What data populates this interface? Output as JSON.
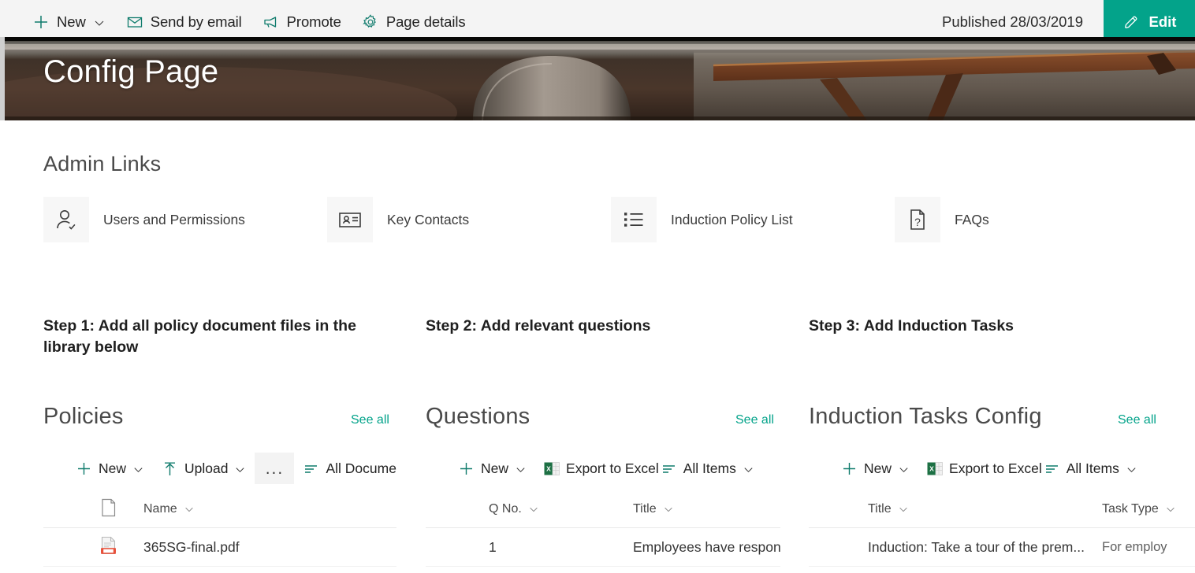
{
  "commandbar": {
    "items": [
      {
        "label": "New",
        "icon": "plus-icon",
        "has_chevron": true
      },
      {
        "label": "Send by email",
        "icon": "mail-icon",
        "has_chevron": false
      },
      {
        "label": "Promote",
        "icon": "megaphone-icon",
        "has_chevron": false
      },
      {
        "label": "Page details",
        "icon": "gear-icon",
        "has_chevron": false
      }
    ],
    "published_status": "Published 28/03/2019",
    "edit_label": "Edit",
    "edit_icon": "pencil-icon",
    "accent_color": "#03a38a"
  },
  "hero": {
    "title": "Config Page"
  },
  "admin_links": {
    "heading": "Admin Links",
    "items": [
      {
        "label": "Users and Permissions",
        "icon": "user-check-icon"
      },
      {
        "label": "Key Contacts",
        "icon": "contact-card-icon"
      },
      {
        "label": "Induction Policy List",
        "icon": "bulleted-list-icon"
      },
      {
        "label": "FAQs",
        "icon": "question-document-icon"
      }
    ]
  },
  "steps": [
    {
      "text": "Step 1: Add all policy document files in the library below"
    },
    {
      "text": "Step 2: Add relevant questions"
    },
    {
      "text": "Step 3: Add Induction Tasks"
    }
  ],
  "webparts": [
    {
      "title": "Policies",
      "see_all": "See all",
      "toolbar": [
        {
          "label": "New",
          "icon": "plus-icon",
          "has_chevron": true
        },
        {
          "label": "Upload",
          "icon": "upload-arrow-icon",
          "has_chevron": true
        },
        {
          "label": "...",
          "icon": "ellipsis-icon",
          "is_ellipsis": true
        },
        {
          "label": "All Documents",
          "icon": "view-list-icon",
          "has_chevron": true
        }
      ],
      "columns": [
        {
          "label": "",
          "icon": "file-type-icon"
        },
        {
          "label": "Name",
          "has_chevron": true
        }
      ],
      "rows": [
        {
          "icon": "pdf-file-icon",
          "name": "365SG-final.pdf"
        }
      ]
    },
    {
      "title": "Questions",
      "see_all": "See all",
      "toolbar": [
        {
          "label": "New",
          "icon": "plus-icon",
          "has_chevron": true
        },
        {
          "label": "Export to Excel",
          "icon": "excel-icon",
          "has_chevron": false
        },
        {
          "label": "All Items",
          "icon": "view-list-icon",
          "has_chevron": true
        }
      ],
      "columns": [
        {
          "label": "Q No.",
          "has_chevron": true
        },
        {
          "label": "Title",
          "has_chevron": true
        }
      ],
      "rows": [
        {
          "qno": "1",
          "title": "Employees have respons"
        }
      ]
    },
    {
      "title": "Induction Tasks Config",
      "see_all": "See all",
      "toolbar": [
        {
          "label": "New",
          "icon": "plus-icon",
          "has_chevron": true
        },
        {
          "label": "Export to Excel",
          "icon": "excel-icon",
          "has_chevron": false
        },
        {
          "label": "All Items",
          "icon": "view-list-icon",
          "has_chevron": true
        }
      ],
      "columns": [
        {
          "label": "Title",
          "has_chevron": true
        },
        {
          "label": "Task Type",
          "has_chevron": true
        }
      ],
      "rows": [
        {
          "title": "Induction: Take a tour of the prem...",
          "task_type": "For employ"
        }
      ]
    }
  ]
}
